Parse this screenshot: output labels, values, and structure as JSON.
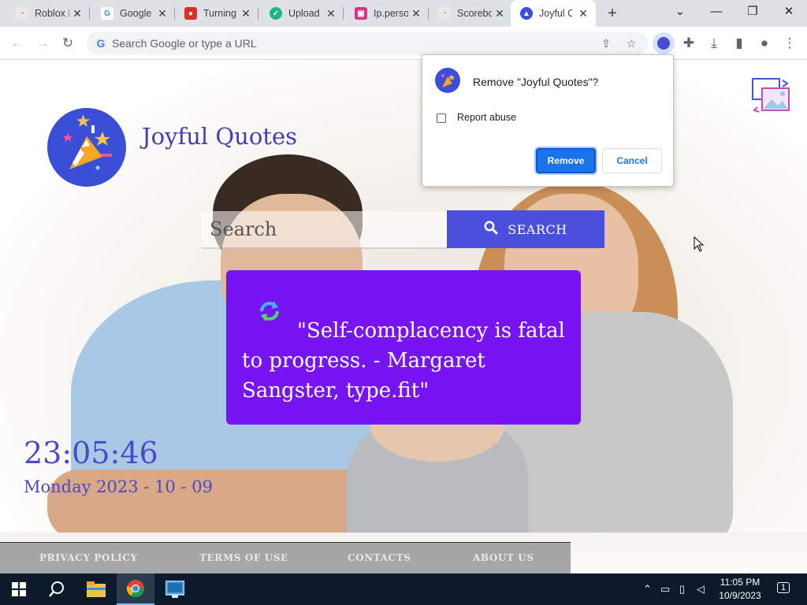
{
  "browser": {
    "tabs": [
      {
        "title": "Roblox I",
        "fav_color": "#e8e8e8",
        "fav_glyph": "R"
      },
      {
        "title": "Google",
        "fav_color": "#ffffff",
        "fav_glyph": "G"
      },
      {
        "title": "Turning",
        "fav_color": "#d93025",
        "fav_glyph": "T"
      },
      {
        "title": "Upload",
        "fav_color": "#1fb584",
        "fav_glyph": "U"
      },
      {
        "title": "Ip.perso",
        "fav_color": "#d63384",
        "fav_glyph": "I"
      },
      {
        "title": "Scorebo",
        "fav_color": "#e8e8e8",
        "fav_glyph": "S"
      },
      {
        "title": "Joyful C",
        "fav_color": "#3a4ed8",
        "fav_glyph": "J"
      }
    ],
    "new_tab_label": "+",
    "omnibox_placeholder": "Search Google or type a URL"
  },
  "page": {
    "site_name": "Joyful Quotes",
    "search_placeholder": "Search",
    "search_button_label": "SEARCH",
    "quote": "\"Self-complacency is fatal to progress. - Margaret Sangster, type.fit\"",
    "time": "23:05:46",
    "date": "Monday 2023 - 10 - 09",
    "footer_links": [
      "PRIVACY POLICY",
      "TERMS OF USE",
      "CONTACTS",
      "ABOUT US"
    ]
  },
  "dialog": {
    "title": "Remove \"Joyful Quotes\"?",
    "checkbox_label": "Report abuse",
    "checkbox_checked": false,
    "primary_label": "Remove",
    "secondary_label": "Cancel"
  },
  "taskbar": {
    "time": "11:05 PM",
    "date": "10/9/2023",
    "notification_count": "1"
  },
  "colors": {
    "accent": "#4a4fdc",
    "quote_card": "#7614f2",
    "clock_text": "#4a4ac8",
    "dialog_primary": "#1a73e8"
  }
}
